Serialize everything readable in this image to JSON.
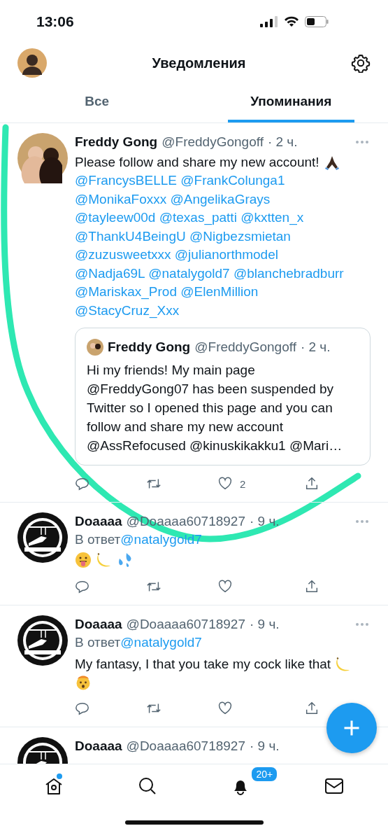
{
  "status_bar": {
    "time": "13:06"
  },
  "header": {
    "title": "Уведомления"
  },
  "tabs": [
    {
      "label": "Все",
      "selected": false
    },
    {
      "label": "Упоминания",
      "selected": true
    }
  ],
  "tweets": [
    {
      "author": "Freddy Gong",
      "handle": "@FreddyGongoff",
      "time": "· 2 ч.",
      "kind": "photo",
      "text": "Please follow and share my new account!",
      "emoji": [
        {
          "kind": "pray"
        }
      ],
      "mention_lines": [
        "@FrancysBELLE @FrankColunga1",
        "@MonikaFoxxx @AngelikaGrays",
        "@tayleew00d @texas_patti @kxtten_x",
        "@ThankU4BeingU @Nigbezsmietan",
        "@zuzusweetxxx @julianorthmodel",
        "@Nadja69L @natalygold7 @blanchebradburr",
        "@Mariskax_Prod @ElenMillion",
        "@StacyCruz_Xxx"
      ],
      "quote": {
        "author": "Freddy Gong",
        "handle": "@FreddyGongoff",
        "time": "· 2 ч.",
        "text": "Hi my friends! My main page @FreddyGong07 has been suspended by Twitter so I opened this page and you can follow and share my new account @AssRefocused @kinuskikakku1 @Mari…"
      },
      "like_count": "2"
    },
    {
      "author": "Doaaaa",
      "handle": "@Doaaaa60718927",
      "time": "· 9 ч.",
      "kind": "logo",
      "reply_label": "В ответ",
      "reply_handle": "@natalygold7",
      "emoji": [
        {
          "kind": "tongue"
        },
        {
          "kind": "banana"
        },
        {
          "kind": "drops"
        }
      ]
    },
    {
      "author": "Doaaaa",
      "handle": "@Doaaaa60718927",
      "time": "· 9 ч.",
      "kind": "logo",
      "reply_label": "В ответ",
      "reply_handle": "@natalygold7",
      "text": "My fantasy, I that you take my cock like that",
      "emoji": [
        {
          "kind": "banana"
        },
        {
          "kind": "mindblown"
        }
      ]
    },
    {
      "author": "Doaaaa",
      "handle": "@Doaaaa60718927",
      "time": "· 9 ч.",
      "kind": "logo"
    }
  ],
  "bottom_nav": {
    "home_new": true,
    "notification_badge": "20+"
  }
}
